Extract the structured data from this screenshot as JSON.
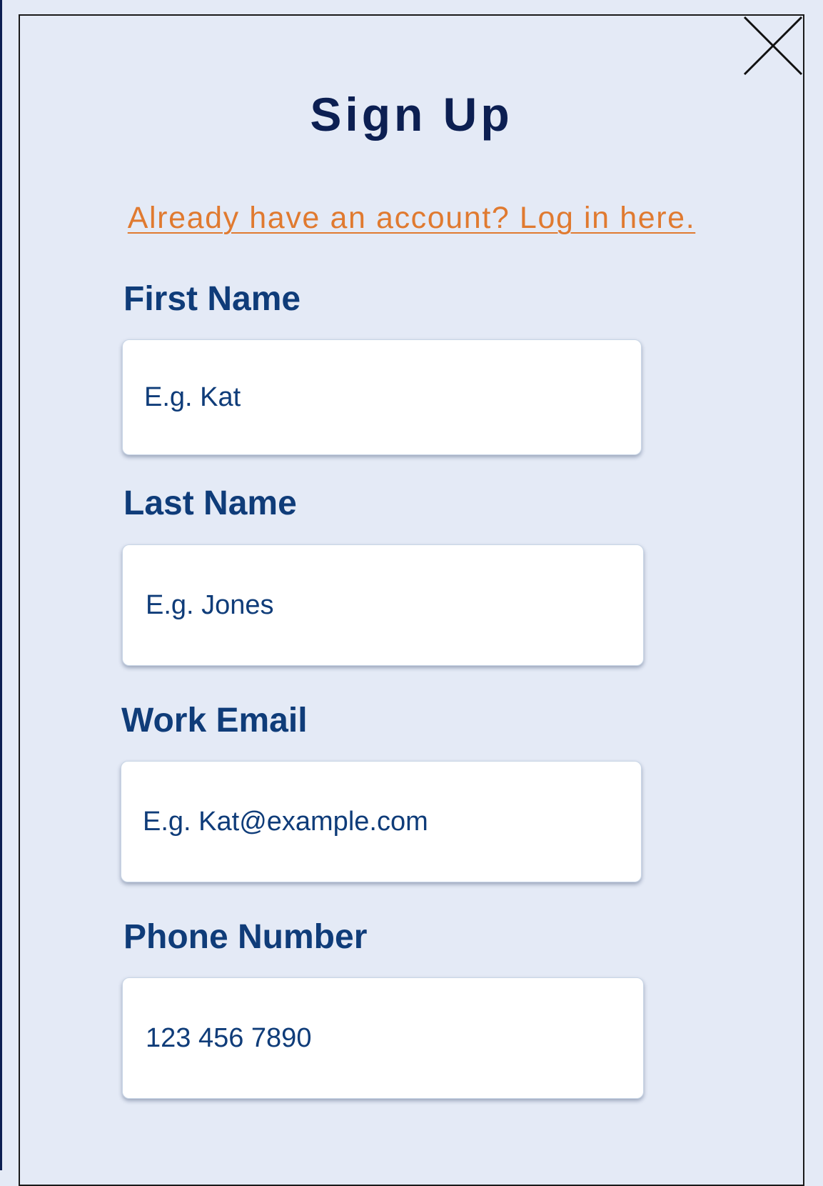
{
  "modal": {
    "title": "Sign Up",
    "login_link": "Already have an account? Log in here.",
    "close_icon": "close-icon"
  },
  "form": {
    "first_name": {
      "label": "First Name",
      "placeholder": "E.g. Kat",
      "value": ""
    },
    "last_name": {
      "label": "Last Name",
      "placeholder": "E.g. Jones",
      "value": ""
    },
    "work_email": {
      "label": "Work Email",
      "placeholder": "E.g. Kat@example.com",
      "value": ""
    },
    "phone_number": {
      "label": "Phone Number",
      "placeholder": "123 456 7890",
      "value": ""
    }
  },
  "colors": {
    "background": "#e4eaf6",
    "title": "#0c1f52",
    "label": "#0f3c79",
    "link": "#e07a30",
    "input_bg": "#ffffff"
  }
}
